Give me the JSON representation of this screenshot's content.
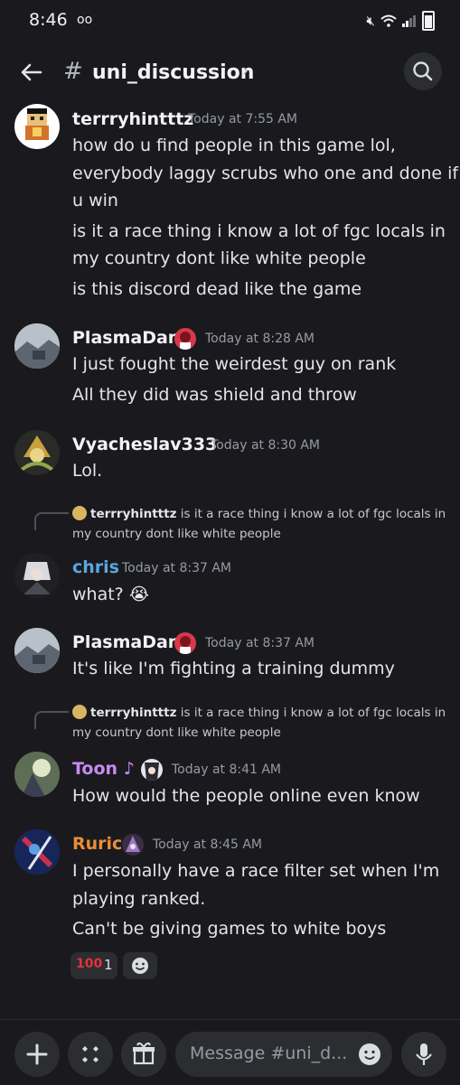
{
  "status": {
    "time": "8:46",
    "voicemail": "oo"
  },
  "header": {
    "hash": "#",
    "channel": "uni_discussion",
    "chevron": "›"
  },
  "colors": {
    "background": "#1a1a1e",
    "author_default": "#f2f3f5",
    "author_chris": "#5aa7e0",
    "author_toon": "#c68bf0",
    "author_ruric": "#e98d3a",
    "timestamp": "#949ba4"
  },
  "messages": [
    {
      "author": "terrryhintttz",
      "time": "Today at 7:55 AM",
      "lines": [
        "how do u find people in this game lol,",
        "everybody laggy scrubs who one and done if",
        "u win",
        "is it a race thing i know a lot of fgc locals in",
        "my country dont like white people",
        "is this discord dead like the game"
      ]
    },
    {
      "author": "PlasmaDan",
      "time": "Today at 8:28 AM",
      "lines": [
        "I just fought the weirdest guy on rank",
        "All they did was shield and throw"
      ]
    },
    {
      "author": "Vyacheslav333",
      "time": "Today at 8:30 AM",
      "lines": [
        "Lol."
      ]
    },
    {
      "reply": {
        "author": "terrryhintttz",
        "text1": "is it a race thing i know a lot of fgc locals in",
        "text2": "my country dont like white people"
      },
      "author": "chris",
      "time": "Today at 8:37 AM",
      "lines": [
        "what?"
      ],
      "emoji": "😭"
    },
    {
      "author": "PlasmaDan",
      "time": "Today at 8:37 AM",
      "lines": [
        "It's like I'm fighting a training dummy"
      ]
    },
    {
      "reply": {
        "author": "terrryhintttz",
        "text1": "is it a race thing i know a lot of fgc locals in",
        "text2": "my country dont like white people"
      },
      "author": "Toon",
      "author_suffix": "♪",
      "time": "Today at 8:41 AM",
      "lines": [
        "How would the people online even know"
      ]
    },
    {
      "author": "Ruric",
      "time": "Today at 8:45 AM",
      "lines": [
        "I personally have a race filter set when I'm",
        "playing ranked.",
        "Can't be giving games to white boys"
      ],
      "reaction": {
        "emoji": "100",
        "count": "1"
      }
    }
  ],
  "composer": {
    "placeholder": "Message #uni_d..."
  },
  "icons": [
    "back-arrow-icon",
    "hash-icon",
    "search-icon",
    "plus-icon",
    "apps-icon",
    "gift-icon",
    "emoji-icon",
    "microphone-icon",
    "add-reaction-icon"
  ]
}
